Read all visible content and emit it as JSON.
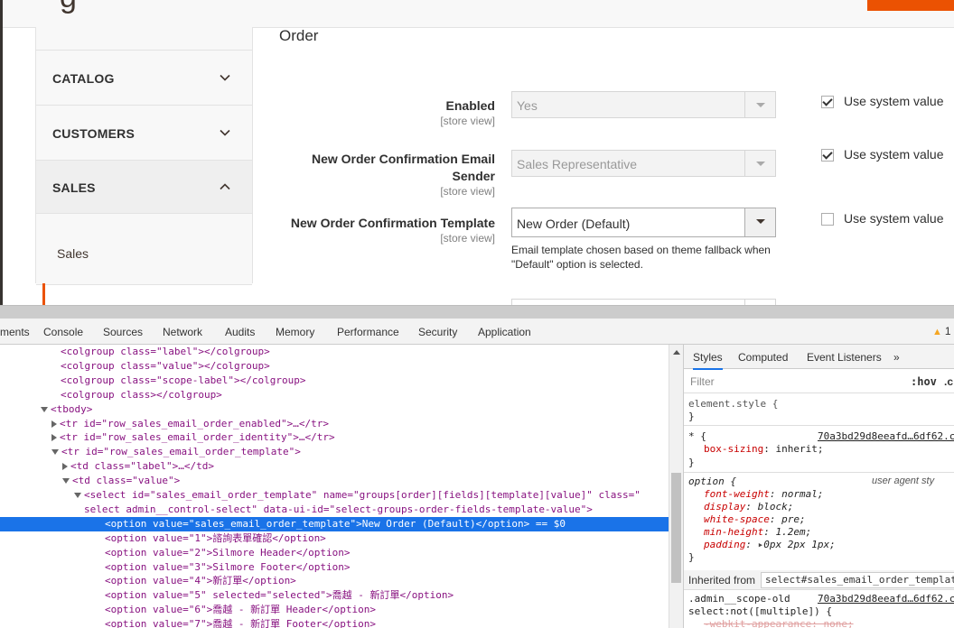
{
  "page": {
    "section_title": "Order",
    "sidebar": {
      "sections": [
        {
          "title": "CATALOG"
        },
        {
          "title": "CUSTOMERS"
        },
        {
          "title": "SALES"
        }
      ],
      "sub_item": "Sales"
    },
    "rows": [
      {
        "label": "Enabled",
        "scope": "[store view]",
        "value": "Yes",
        "use_system": "Use system value",
        "checked": true
      },
      {
        "label": "New Order Confirmation Email Sender",
        "scope": "[store view]",
        "value": "Sales Representative",
        "use_system": "Use system value",
        "checked": true
      },
      {
        "label": "New Order Confirmation Template",
        "scope": "[store view]",
        "value": "New Order (Default)",
        "use_system": "Use system value",
        "checked": false
      }
    ],
    "note": "Email template chosen based on theme fallback when \"Default\" option is selected."
  },
  "devtools": {
    "tabs": [
      "ments",
      "Console",
      "Sources",
      "Network",
      "Audits",
      "Memory",
      "Performance",
      "Security",
      "Application"
    ],
    "warning_count": "1",
    "dom_lines": [
      "<colgroup class=\"label\"></colgroup>",
      "<colgroup class=\"value\"></colgroup>",
      "<colgroup class=\"scope-label\"></colgroup>",
      "<colgroup class></colgroup>",
      "<tbody>",
      "<tr id=\"row_sales_email_order_enabled\">…</tr>",
      "<tr id=\"row_sales_email_order_identity\">…</tr>",
      "<tr id=\"row_sales_email_order_template\">",
      "<td class=\"label\">…</td>",
      "<td class=\"value\">",
      "<select id=\"sales_email_order_template\" name=\"groups[order][fields][template][value]\" class=\"",
      "select admin__control-select\" data-ui-id=\"select-groups-order-fields-template-value\">",
      "<option value=\"sales_email_order_template\">New Order (Default)</option> == $0",
      "<option value=\"1\">諮詢表單確認</option>",
      "<option value=\"2\">Silmore Header</option>",
      "<option value=\"3\">Silmore Footer</option>",
      "<option value=\"4\">新訂單</option>",
      "<option value=\"5\" selected=\"selected\">喬越 - 新訂單</option>",
      "<option value=\"6\">喬越 - 新訂單 Header</option>",
      "<option value=\"7\">喬越 - 新訂單 Footer</option>"
    ],
    "styles": {
      "tabs": [
        "Styles",
        "Computed",
        "Event Listeners",
        "»"
      ],
      "filter_placeholder": "Filter",
      "hov": ":hov",
      "cls": ".c",
      "element_style": "element.style {",
      "close_brace": "}",
      "rule1_selector": "* {",
      "rule1_source": "70a3bd29d8eeafd…6df62.c",
      "rule1_prop": "box-sizing",
      "rule1_val": "inherit;",
      "rule2_selector": "option {",
      "rule2_source": "user agent sty",
      "rule2_props": [
        {
          "p": "font-weight",
          "v": "normal;"
        },
        {
          "p": "display",
          "v": "block;"
        },
        {
          "p": "white-space",
          "v": "pre;"
        },
        {
          "p": "min-height",
          "v": "1.2em;"
        },
        {
          "p": "padding",
          "v": "0px 2px 1px;"
        }
      ],
      "inherited_label": "Inherited from",
      "inherited_selector": "select#sales_email_order_templat",
      "rule3_selector_a": ".admin__scope-old",
      "rule3_selector_b": "select:not([multiple]) {",
      "rule3_source": "70a3bd29d8eeafd…6df62.c",
      "rule3_prop": "-webkit-appearance: none;"
    }
  }
}
